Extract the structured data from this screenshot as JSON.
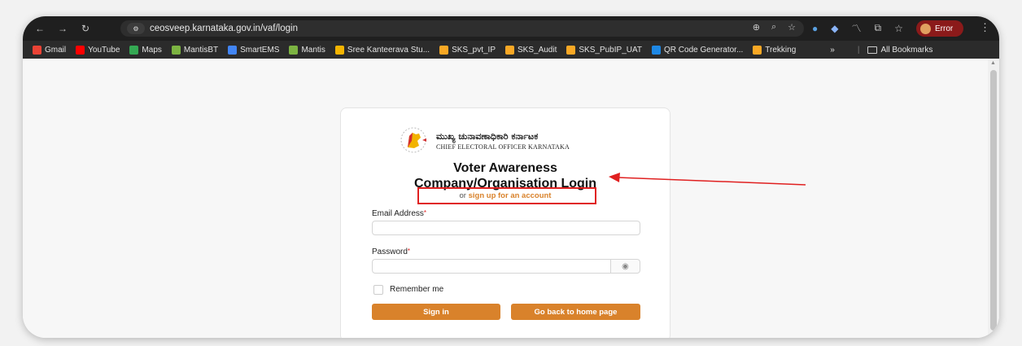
{
  "browser": {
    "url": "ceosveep.karnataka.gov.in/vaf/login",
    "error_label": "Error",
    "bookmarks": [
      {
        "label": "Gmail",
        "color": "#ea4335"
      },
      {
        "label": "YouTube",
        "color": "#ff0000"
      },
      {
        "label": "Maps",
        "color": "#34a853"
      },
      {
        "label": "MantisBT",
        "color": "#7cb342"
      },
      {
        "label": "SmartEMS",
        "color": "#4285f4"
      },
      {
        "label": "Mantis",
        "color": "#7cb342"
      },
      {
        "label": "Sree Kanteerava Stu...",
        "color": "#f4b400"
      },
      {
        "label": "SKS_pvt_IP",
        "color": "#f9a825"
      },
      {
        "label": "SKS_Audit",
        "color": "#f9a825"
      },
      {
        "label": "SKS_PubIP_UAT",
        "color": "#f9a825"
      },
      {
        "label": "QR Code Generator...",
        "color": "#1e88e5"
      },
      {
        "label": "Trekking",
        "color": "#f9a825"
      }
    ],
    "more_bookmarks": "»",
    "all_bookmarks": "All Bookmarks"
  },
  "login": {
    "logo_kannada": "ಮುಖ್ಯ ಚುನಾವಣಾಧಿಕಾರಿ ಕರ್ನಾಟಕ",
    "logo_english": "CHIEF ELECTORAL OFFICER KARNATAKA",
    "title_line1": "Voter Awareness",
    "title_line2": "Company/Organisation Login",
    "signup_prefix": "or",
    "signup_link": "sign up for an account",
    "email_label": "Email Address",
    "password_label": "Password",
    "required_mark": "*",
    "remember_label": "Remember me",
    "signin_button": "Sign in",
    "home_button": "Go back to home page"
  },
  "colors": {
    "accent": "#d9822b",
    "highlight": "#e02020"
  }
}
